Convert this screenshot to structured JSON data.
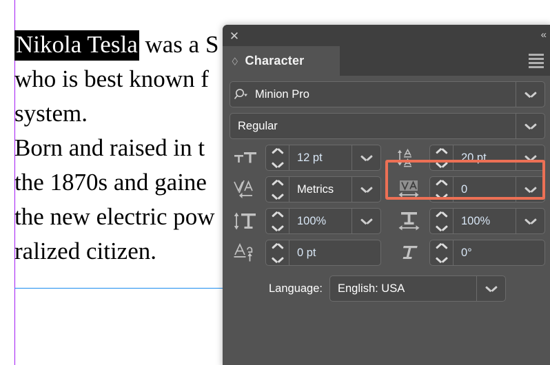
{
  "document": {
    "lines": [
      {
        "selected": "Nikola Tesla",
        "rest": " was a S"
      },
      {
        "selected": "",
        "rest": "who is best known f"
      },
      {
        "selected": "",
        "rest": "system."
      },
      {
        "selected": "",
        "rest": "Born and raised in t"
      },
      {
        "selected": "",
        "rest": "the 1870s and gaine"
      },
      {
        "selected": "",
        "rest": "the new electric pow"
      },
      {
        "selected": "",
        "rest": "ralized citizen."
      }
    ],
    "guide_color_vertical": "#a31bf5",
    "guide_color_horizontal": "#1a8cf0"
  },
  "panel": {
    "titlebar": {
      "close_glyph": "✕",
      "collapse_glyph": "«"
    },
    "tab": {
      "diamond_glyph": "◇",
      "label": "Character"
    },
    "menu_name": "panel-menu",
    "font_family": {
      "value": "Minion Pro",
      "icon": "search-font-icon"
    },
    "font_style": {
      "value": "Regular"
    },
    "font_size": {
      "icon": "font-size-icon",
      "value": "12 pt"
    },
    "leading": {
      "icon": "leading-icon",
      "value": "20 pt",
      "highlight_color": "#ec7055"
    },
    "kerning": {
      "icon": "kerning-icon",
      "value": "Metrics"
    },
    "tracking": {
      "icon": "tracking-icon",
      "value": "0"
    },
    "vertical_scale": {
      "icon": "vertical-scale-icon",
      "value": "100%"
    },
    "horizontal_scale": {
      "icon": "horizontal-scale-icon",
      "value": "100%"
    },
    "baseline_shift": {
      "icon": "baseline-shift-icon",
      "value": "0 pt"
    },
    "skew": {
      "icon": "skew-icon",
      "value": "0°"
    },
    "language": {
      "label": "Language:",
      "value": "English: USA"
    }
  }
}
